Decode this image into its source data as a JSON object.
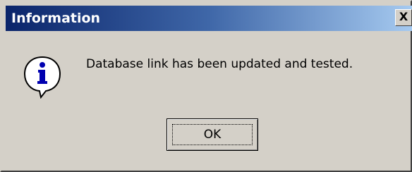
{
  "window": {
    "title": "Information",
    "close_glyph": "X",
    "titlebar_colors": {
      "start": "#0a246a",
      "end": "#a6caf0"
    },
    "face_color": "#d4d0c8"
  },
  "message": {
    "icon": "information-icon",
    "text": "Database link has been updated and tested."
  },
  "buttons": {
    "ok_label": "OK"
  }
}
